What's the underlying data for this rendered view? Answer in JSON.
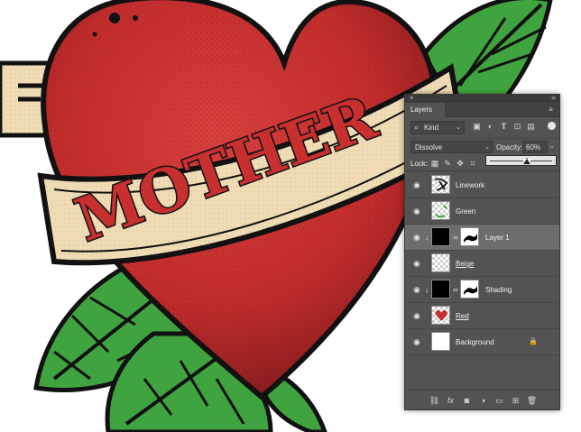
{
  "artwork": {
    "banner_text": "MOTHER",
    "colors": {
      "heart": "#c8302f",
      "leaf": "#3fa43f",
      "banner": "#efdcb5",
      "outline": "#111111"
    }
  },
  "panel": {
    "title_tab": "Layers",
    "close_icon": "close-icon",
    "collapse_icon": "double-chevron-icon",
    "menu_icon": "hamburger-menu-icon",
    "filter": {
      "kind_label": "Kind",
      "icons": [
        "image-filter-icon",
        "adjustment-filter-icon",
        "type-filter-icon",
        "shape-filter-icon",
        "smart-object-filter-icon"
      ]
    },
    "blend_mode": "Dissolve",
    "opacity_label": "Opacity:",
    "opacity_value": "60%",
    "lock_label": "Lock:",
    "lock_icons": [
      "lock-transparent-icon",
      "lock-paint-icon",
      "lock-move-icon",
      "lock-artboard-icon"
    ],
    "slider_value": 0.6,
    "layers": [
      {
        "name": "Linework",
        "thumb": "linework",
        "underline": false,
        "selected": false,
        "clip": false,
        "mask": false,
        "locked": false
      },
      {
        "name": "Green",
        "thumb": "green",
        "underline": false,
        "selected": false,
        "clip": false,
        "mask": false,
        "locked": false
      },
      {
        "name": "Layer 1",
        "thumb": "black",
        "underline": false,
        "selected": true,
        "clip": true,
        "mask": true,
        "locked": false
      },
      {
        "name": "Beige",
        "thumb": "checker",
        "underline": true,
        "selected": false,
        "clip": false,
        "mask": false,
        "locked": false
      },
      {
        "name": "Shading",
        "thumb": "black",
        "underline": false,
        "selected": false,
        "clip": true,
        "mask": true,
        "locked": false
      },
      {
        "name": "Red",
        "thumb": "red",
        "underline": true,
        "selected": false,
        "clip": false,
        "mask": false,
        "locked": false
      },
      {
        "name": "Background",
        "thumb": "white",
        "underline": false,
        "selected": false,
        "clip": false,
        "mask": false,
        "locked": true
      }
    ],
    "bottom_icons": [
      "link-layers-icon",
      "fx-icon",
      "add-mask-icon",
      "adjustment-layer-icon",
      "new-group-icon",
      "new-layer-icon",
      "trash-icon"
    ],
    "fx_label": "fx"
  }
}
